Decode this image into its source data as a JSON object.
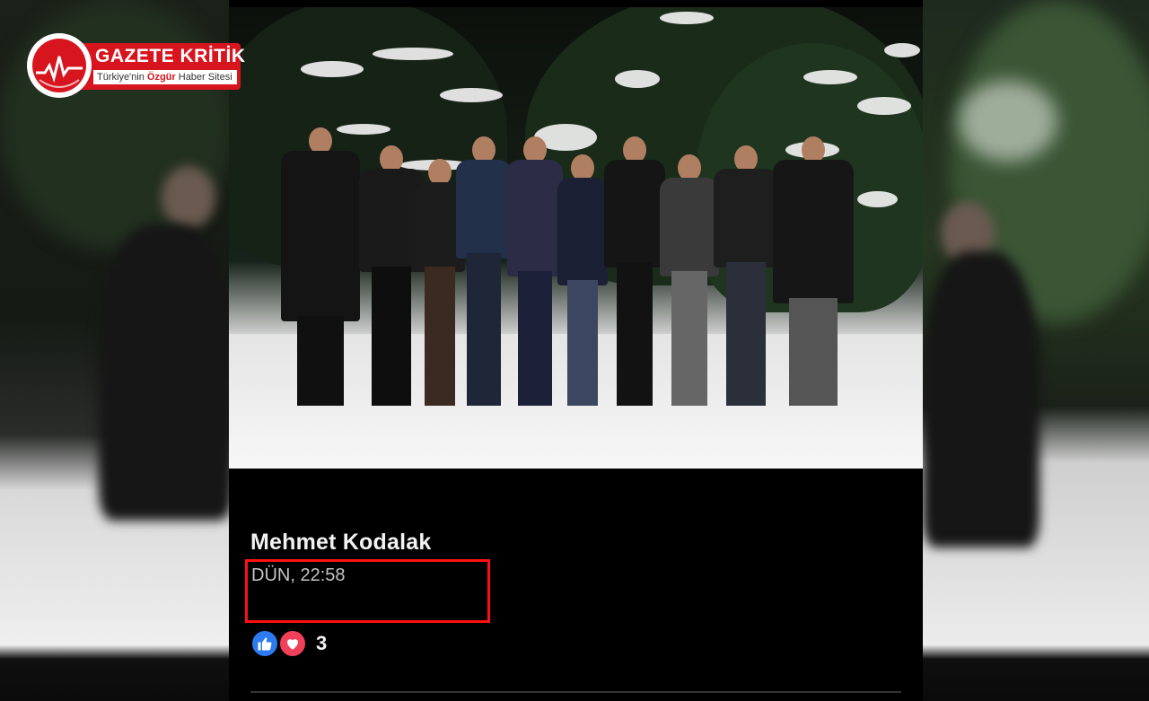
{
  "logo": {
    "title": "GAZETE KRİTİK",
    "subtitle_pre": "Türkiye'nin ",
    "subtitle_highlight": "Özgür",
    "subtitle_post": " Haber Sitesi"
  },
  "post": {
    "author": "Mehmet Kodalak",
    "timestamp": "DÜN, 22:58",
    "reactions": {
      "icons": [
        "like-icon",
        "love-icon"
      ],
      "count": "3"
    }
  },
  "colors": {
    "brand_red": "#d7151f",
    "highlight_border": "#ff1010",
    "like_blue": "#2d7bf0",
    "love_red": "#f0405a"
  }
}
